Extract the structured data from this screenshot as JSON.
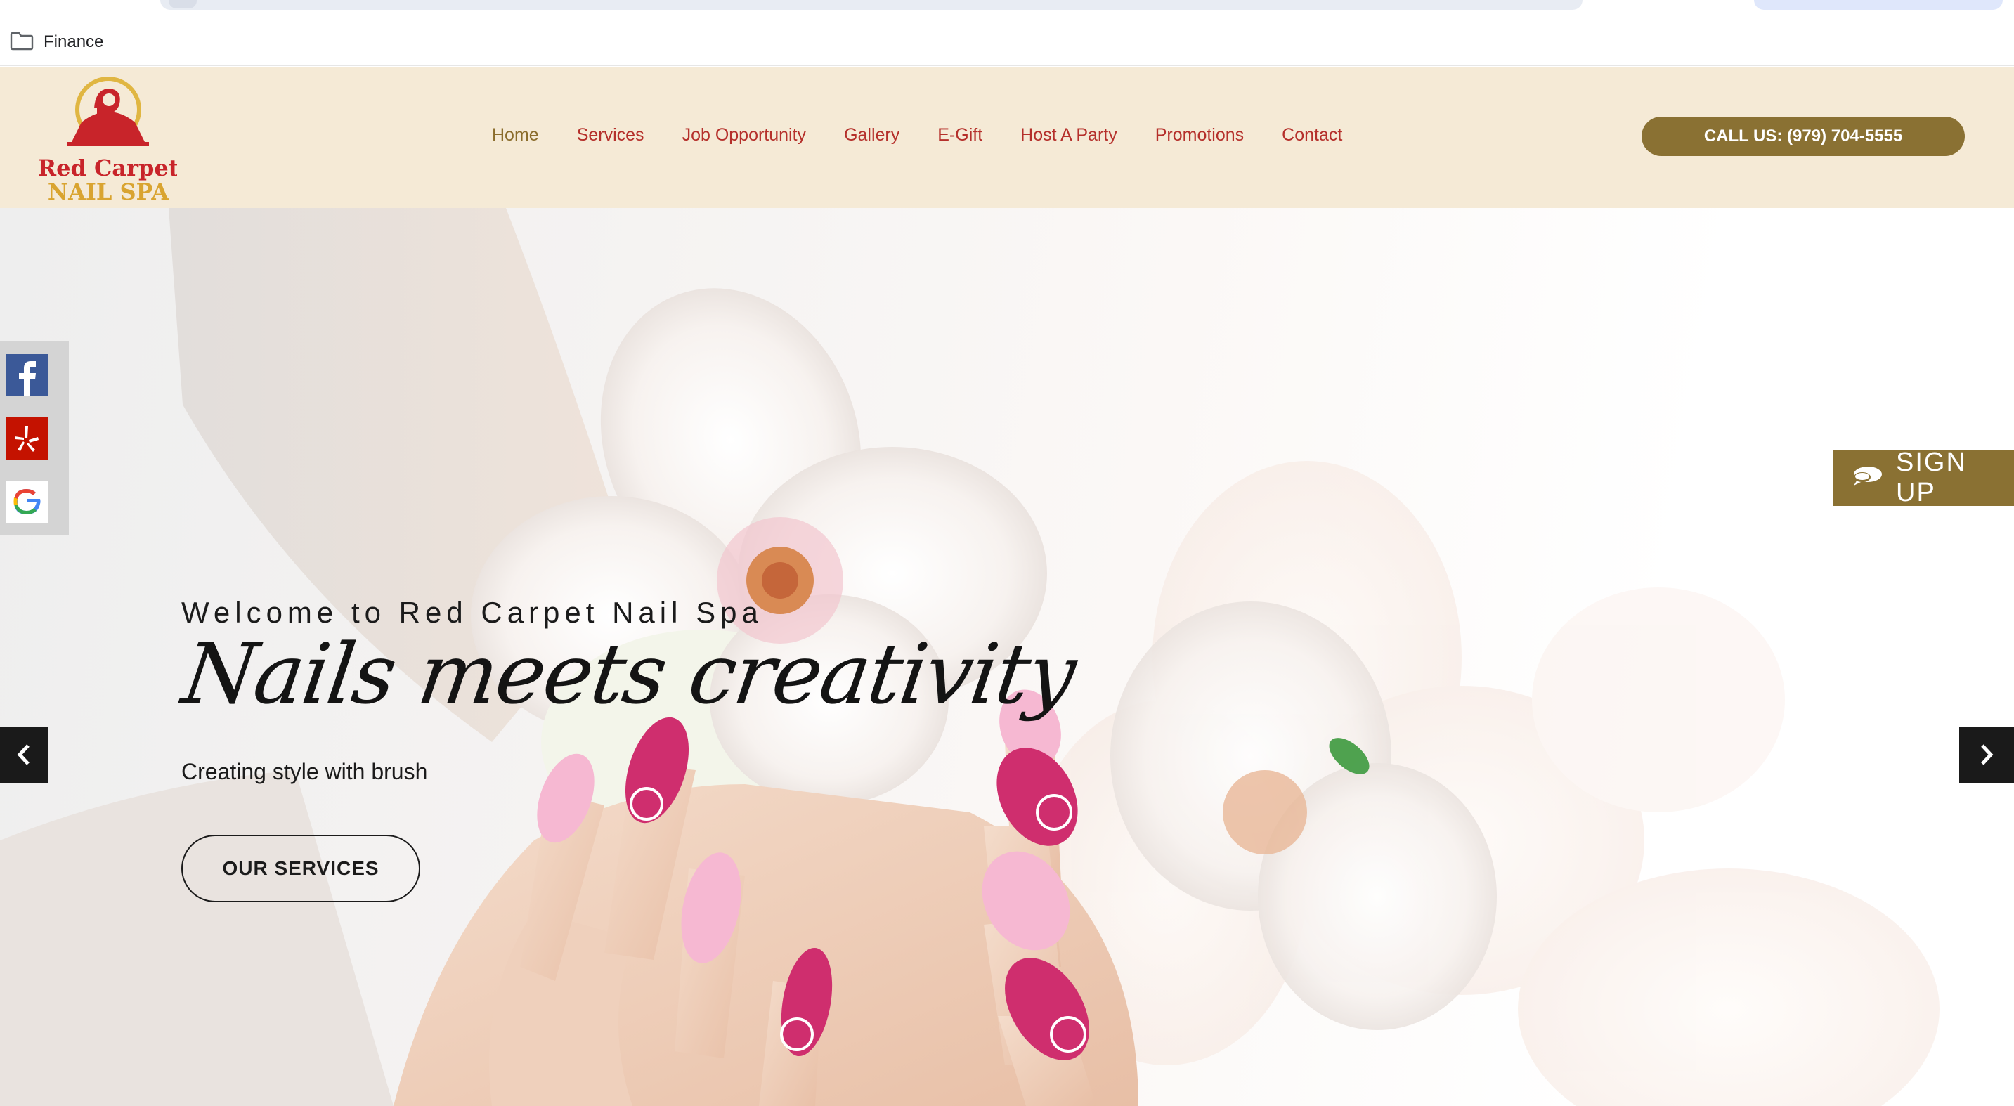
{
  "browser": {
    "bookmark": {
      "label": "Finance",
      "icon": "folder-icon"
    }
  },
  "header": {
    "logo": {
      "line1": "Red Carpet",
      "line2": "NAIL SPA"
    },
    "nav": [
      {
        "label": "Home",
        "active": true
      },
      {
        "label": "Services"
      },
      {
        "label": "Job Opportunity"
      },
      {
        "label": "Gallery"
      },
      {
        "label": "E-Gift"
      },
      {
        "label": "Host A Party"
      },
      {
        "label": "Promotions"
      },
      {
        "label": "Contact"
      }
    ],
    "call_label": "CALL US: (979) 704-5555"
  },
  "social": [
    {
      "name": "facebook-icon",
      "color": "#3b5998"
    },
    {
      "name": "yelp-icon",
      "color": "#c41200"
    },
    {
      "name": "google-icon",
      "color": "#4285f4"
    }
  ],
  "signup": {
    "label": "SIGN UP",
    "icon": "chat-bubble-icon"
  },
  "hero": {
    "welcome": "Welcome to Red Carpet Nail Spa",
    "tagline": "Nails meets creativity",
    "subtagline": "Creating style with brush",
    "button_label": "OUR SERVICES"
  },
  "colors": {
    "header_bg": "#f5ead6",
    "nav_text": "#b5302b",
    "nav_active": "#8b6d2c",
    "accent_gold": "#8a7133",
    "nail_pink": "#f6b8d2",
    "nail_magenta": "#cf2e6e"
  }
}
